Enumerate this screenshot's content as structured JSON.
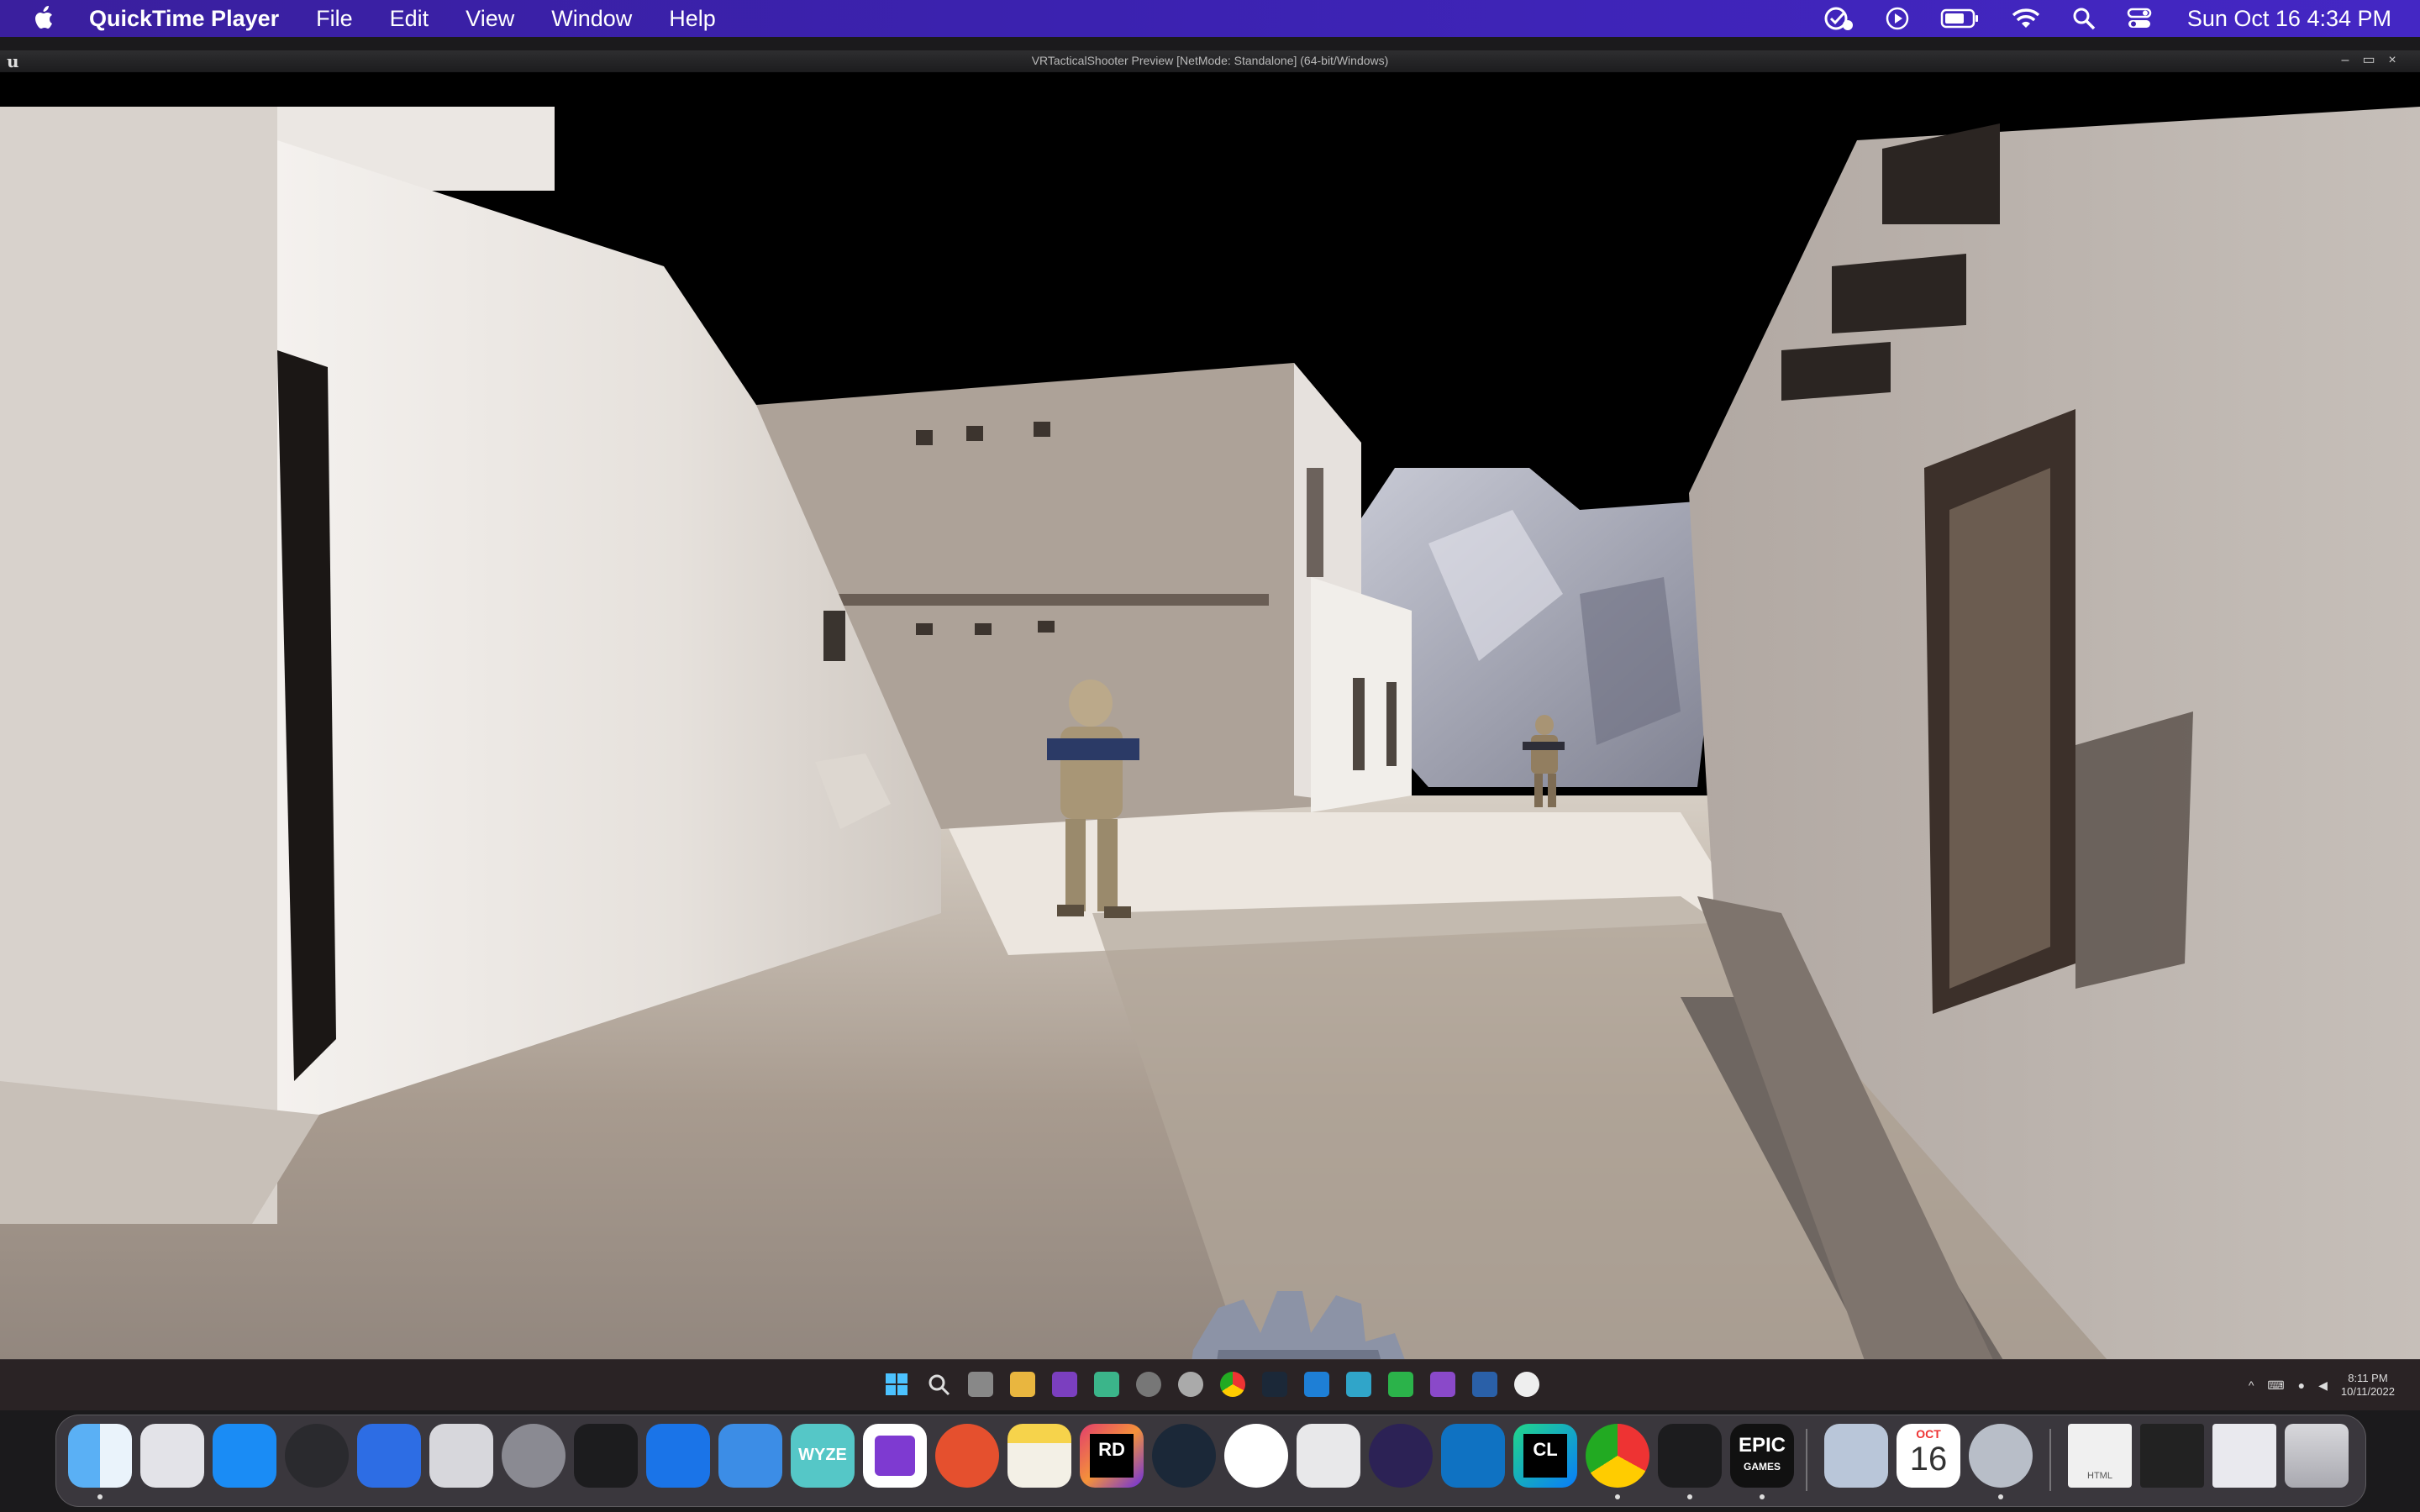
{
  "menubar": {
    "app_name": "QuickTime Player",
    "menus": [
      "File",
      "Edit",
      "View",
      "Window",
      "Help"
    ],
    "clock": "Sun Oct 16  4:34 PM",
    "status_icons": [
      "checkmark-badge-icon",
      "play-circle-icon",
      "battery-icon",
      "wifi-icon",
      "spotlight-search-icon",
      "control-center-icon"
    ]
  },
  "game_window": {
    "title": "VRTacticalShooter Preview [NetMode: Standalone]  (64-bit/Windows)",
    "controls": [
      "–",
      "▭",
      "×"
    ]
  },
  "windows_taskbar": {
    "icons": [
      "start-icon",
      "search-icon",
      "task-view-icon",
      "file-explorer-icon",
      "onenote-icon",
      "app-icon",
      "chrome-dev-icon",
      "obs-icon",
      "chrome-icon",
      "steam-icon",
      "vscode-icon",
      "terminal-icon",
      "media-player-icon",
      "visual-studio-icon",
      "powershell-icon",
      "unreal-engine-icon"
    ],
    "tray_time": "8:11 PM",
    "tray_date": "10/11/2022"
  },
  "dock": {
    "apps": [
      "finder",
      "launchpad",
      "app-store",
      "compressor",
      "swift-playgrounds",
      "preview-scanner",
      "system-preferences",
      "terminal",
      "xcode-instruments",
      "xcode",
      "wyze",
      "onenote",
      "remote-desktop",
      "notes",
      "rider",
      "steam",
      "testflight",
      "unity",
      "eclipse",
      "vscode",
      "clion",
      "chrome",
      "terminal-2",
      "epic-games",
      "file-merge",
      "calendar",
      "quicktime"
    ],
    "labels": {
      "wyze": "WYZE",
      "rider": "RD",
      "clion": "CL",
      "epic_line1": "EPIC",
      "epic_line2": "GAMES",
      "calendar_month": "OCT",
      "calendar_day": "16",
      "doc_label": "HTML"
    }
  },
  "colors": {
    "menubar": "#3b22b0",
    "sky": "#000000",
    "sand": "#b7aa9d",
    "wall_light": "#e6e1dd"
  }
}
